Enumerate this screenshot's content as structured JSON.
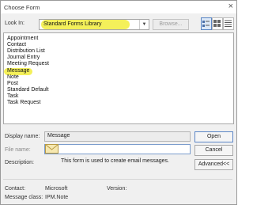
{
  "window": {
    "title": "Choose Form",
    "close_glyph": "×"
  },
  "toolbar": {
    "look_in_label": "Look In:",
    "look_in_value": "Standard Forms Library",
    "browse_label": "Browse...",
    "view_buttons": [
      "large-icons-icon",
      "small-icons-icon",
      "details-icon"
    ]
  },
  "form_list": {
    "items": [
      "Appointment",
      "Contact",
      "Distribution List",
      "Journal Entry",
      "Meeting Request",
      "Message",
      "Note",
      "Post",
      "Standard Default",
      "Task",
      "Task Request"
    ],
    "selected": "Message",
    "highlight_color": "#f4f05a"
  },
  "details": {
    "display_name_label": "Display name:",
    "display_name_value": "Message",
    "file_name_label": "File name:",
    "file_name_value": "",
    "description_label": "Description:",
    "description_text": "This form is used to create email messages.",
    "contact_label": "Contact:",
    "contact_value": "Microsoft",
    "version_label": "Version:",
    "version_value": "",
    "message_class_label": "Message class:",
    "message_class_value": "IPM.Note"
  },
  "buttons": {
    "open": "Open",
    "cancel": "Cancel",
    "advanced": "Advanced<<"
  }
}
